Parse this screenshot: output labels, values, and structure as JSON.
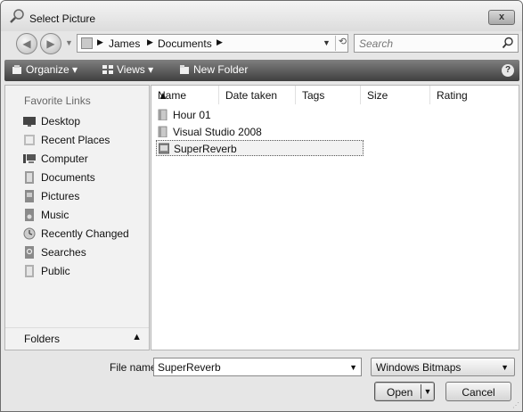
{
  "window": {
    "title": "Select Picture",
    "close_label": "x"
  },
  "address": {
    "crumbs": [
      "James",
      "Documents"
    ],
    "search_placeholder": "Search"
  },
  "toolbar": {
    "organize": "Organize",
    "views": "Views",
    "new_folder": "New Folder",
    "help": "?"
  },
  "sidebar": {
    "header": "Favorite Links",
    "items": [
      {
        "label": "Desktop",
        "icon": "desktop-icon"
      },
      {
        "label": "Recent Places",
        "icon": "recent-places-icon"
      },
      {
        "label": "Computer",
        "icon": "computer-icon"
      },
      {
        "label": "Documents",
        "icon": "documents-icon"
      },
      {
        "label": "Pictures",
        "icon": "pictures-icon"
      },
      {
        "label": "Music",
        "icon": "music-icon"
      },
      {
        "label": "Recently Changed",
        "icon": "recently-changed-icon"
      },
      {
        "label": "Searches",
        "icon": "searches-icon"
      },
      {
        "label": "Public",
        "icon": "public-icon"
      }
    ],
    "folders_label": "Folders"
  },
  "file_list": {
    "columns": [
      "Name",
      "Date taken",
      "Tags",
      "Size",
      "Rating"
    ],
    "items": [
      {
        "name": "Hour 01",
        "type": "folder"
      },
      {
        "name": "Visual Studio 2008",
        "type": "folder"
      },
      {
        "name": "SuperReverb",
        "type": "image",
        "selected": true
      }
    ]
  },
  "footer": {
    "file_name_label": "File name:",
    "file_name_value": "SuperReverb",
    "file_type_value": "Windows Bitmaps",
    "open_label": "Open",
    "cancel_label": "Cancel"
  }
}
